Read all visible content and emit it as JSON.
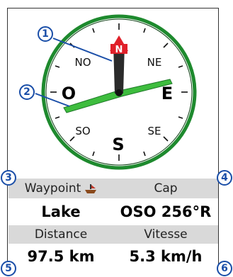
{
  "compass": {
    "north_marker": "N",
    "cardinals": {
      "north": "N",
      "east": "E",
      "south": "S",
      "west": "O"
    },
    "intercardinals": {
      "northwest": "NO",
      "northeast": "NE",
      "southwest": "SO",
      "southeast": "SE"
    },
    "heading_deg": 256
  },
  "callouts": [
    "1",
    "2",
    "3",
    "4",
    "5",
    "6"
  ],
  "fields": {
    "waypoint_label": "Waypoint",
    "waypoint_value": "Lake",
    "heading_label": "Cap",
    "heading_value": "OSO 256°R",
    "distance_label": "Distance",
    "distance_value": "97.5 km",
    "speed_label": "Vitesse",
    "speed_value": "5.3 km/h"
  },
  "colors": {
    "ring": "#1e8a2e",
    "bearing_pointer": "#3ebd3e",
    "north_marker": "#e0202a",
    "callout": "#1a4ea8"
  }
}
